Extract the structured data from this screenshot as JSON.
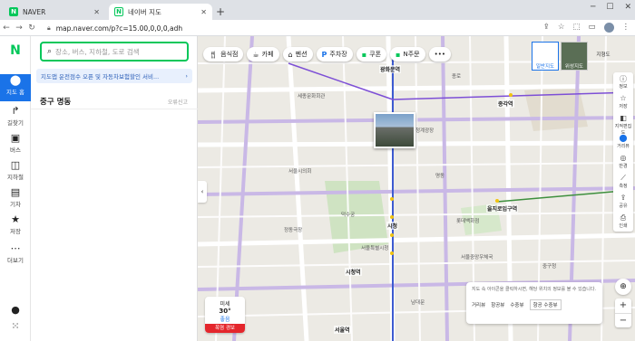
{
  "browser": {
    "tabs": [
      {
        "title": "NAVER",
        "favicon": "N"
      },
      {
        "title": "네이버 지도",
        "favicon": "N"
      }
    ],
    "url": "map.naver.com/p?c=15.00,0,0,0,adh"
  },
  "leftnav": {
    "items": [
      {
        "label": "지도 홈",
        "icon": "map-pin-icon"
      },
      {
        "label": "길찾기",
        "icon": "directions-icon"
      },
      {
        "label": "버스",
        "icon": "bus-icon"
      },
      {
        "label": "지하철",
        "icon": "subway-icon"
      },
      {
        "label": "기차",
        "icon": "train-icon"
      },
      {
        "label": "저장",
        "icon": "star-icon"
      },
      {
        "label": "더보기",
        "icon": "more-icon"
      }
    ]
  },
  "panel": {
    "search_placeholder": "장소, 버스, 지하철, 도로 검색",
    "banner": "지도앱 운전점수 오픈 및 자동차보험할인 서비...",
    "title": "중구 명동",
    "error_link": "오류신고"
  },
  "map": {
    "chips": [
      {
        "label": "음식점",
        "icon": "utensils-icon"
      },
      {
        "label": "카페",
        "icon": "cafe-icon"
      },
      {
        "label": "펜션",
        "icon": "bed-icon"
      },
      {
        "label": "주차장",
        "icon": "parking-icon"
      },
      {
        "label": "쿠폰",
        "icon": "coupon-icon"
      },
      {
        "label": "N주문",
        "icon": "order-icon"
      }
    ],
    "map_types": [
      "일반지도",
      "위성지도",
      "지형도"
    ],
    "right_tools": [
      "정보",
      "저장",
      "지적편집도",
      "거리뷰",
      "반경",
      "측정",
      "공유",
      "인쇄"
    ],
    "weather": {
      "label": "미세",
      "temp": "30°",
      "quality": "좋음",
      "alert": "폭염 경보"
    },
    "legend": {
      "hint": "지도 속 아이콘을 클릭하시면, 해당 위치의 정보를 볼 수 있습니다.",
      "items": [
        "거리뷰",
        "항공뷰",
        "수중뷰"
      ],
      "option": "항공 수중뷰"
    },
    "stations": [
      "종각역",
      "광화문역",
      "시청",
      "을지로입구역",
      "시청역",
      "서울역"
    ],
    "labels": [
      "덕수궁",
      "명동",
      "서울특별시청",
      "남대문",
      "종로",
      "청계광장",
      "정동극장",
      "서울시의회",
      "롯데백화점",
      "서울중앙우체국",
      "중구청",
      "세종문화회관"
    ]
  }
}
